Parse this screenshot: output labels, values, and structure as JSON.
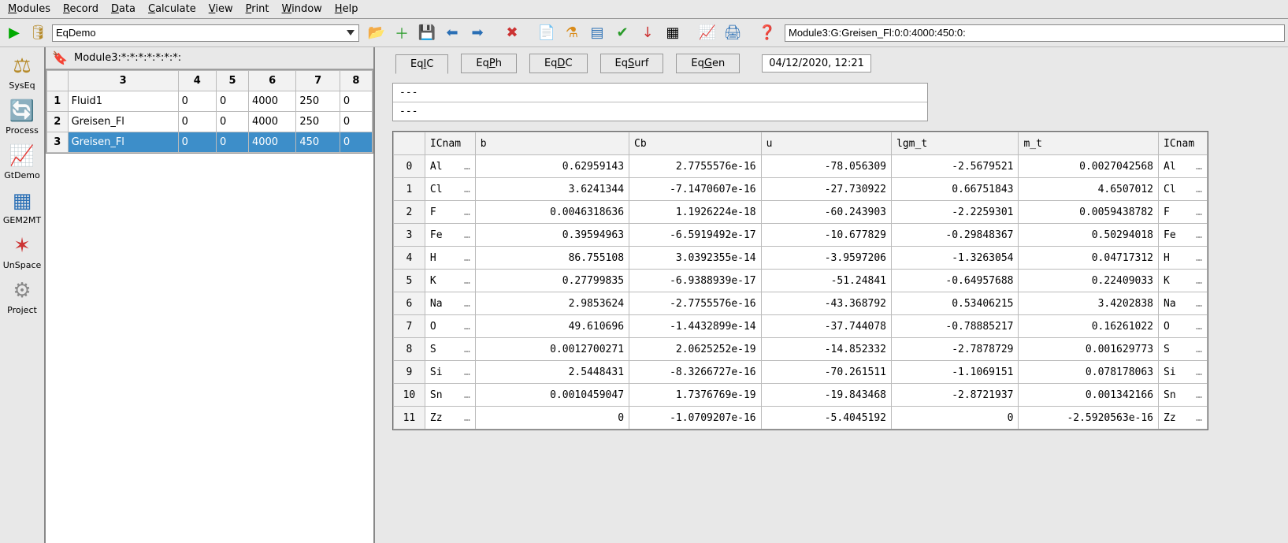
{
  "menu": [
    "Modules",
    "Record",
    "Data",
    "Calculate",
    "View",
    "Print",
    "Window",
    "Help"
  ],
  "module_selected": "EqDemo",
  "path_input": "Module3:G:Greisen_Fl:0:0:4000:450:0:",
  "mid_path": "Module3:*:*:*:*:*:*:*:",
  "rec_headers": [
    "3",
    "4",
    "5",
    "6",
    "7",
    "8"
  ],
  "rec_rows": [
    {
      "n": "1",
      "name": "Fluid1",
      "v": [
        "0",
        "0",
        "4000",
        "250",
        "0"
      ],
      "sel": false
    },
    {
      "n": "2",
      "name": "Greisen_Fl",
      "v": [
        "0",
        "0",
        "4000",
        "250",
        "0"
      ],
      "sel": false
    },
    {
      "n": "3",
      "name": "Greisen_Fl",
      "v": [
        "0",
        "0",
        "4000",
        "450",
        "0"
      ],
      "sel": true
    }
  ],
  "nav": [
    {
      "label": "SysEq",
      "icon": "⚖"
    },
    {
      "label": "Process",
      "icon": "🔄"
    },
    {
      "label": "GtDemo",
      "icon": "📈"
    },
    {
      "label": "GEM2MT",
      "icon": "▦"
    },
    {
      "label": "UnSpace",
      "icon": "✶"
    },
    {
      "label": "Project",
      "icon": "⚙"
    }
  ],
  "tabs": [
    "EqIC",
    "EqPh",
    "EqDC",
    "EqSurf",
    "EqGen"
  ],
  "active_tab": 0,
  "date": "04/12/2020, 12:21",
  "info1": "---",
  "info2": "---",
  "cols": [
    "ICnam",
    "b",
    "Cb",
    "u",
    "lgm_t",
    "m_t",
    "ICnam"
  ],
  "rows": [
    {
      "i": "0",
      "ic": "Al",
      "b": "0.62959143",
      "cb": "2.7755576e-16",
      "u": "-78.056309",
      "lgm": "-2.5679521",
      "mt": "0.0027042568",
      "ic2": "Al"
    },
    {
      "i": "1",
      "ic": "Cl",
      "b": "3.6241344",
      "cb": "-7.1470607e-16",
      "u": "-27.730922",
      "lgm": "0.66751843",
      "mt": "4.6507012",
      "ic2": "Cl"
    },
    {
      "i": "2",
      "ic": "F",
      "b": "0.0046318636",
      "cb": "1.1926224e-18",
      "u": "-60.243903",
      "lgm": "-2.2259301",
      "mt": "0.0059438782",
      "ic2": "F"
    },
    {
      "i": "3",
      "ic": "Fe",
      "b": "0.39594963",
      "cb": "-6.5919492e-17",
      "u": "-10.677829",
      "lgm": "-0.29848367",
      "mt": "0.50294018",
      "ic2": "Fe"
    },
    {
      "i": "4",
      "ic": "H",
      "b": "86.755108",
      "cb": "3.0392355e-14",
      "u": "-3.9597206",
      "lgm": "-1.3263054",
      "mt": "0.04717312",
      "ic2": "H"
    },
    {
      "i": "5",
      "ic": "K",
      "b": "0.27799835",
      "cb": "-6.9388939e-17",
      "u": "-51.24841",
      "lgm": "-0.64957688",
      "mt": "0.22409033",
      "ic2": "K"
    },
    {
      "i": "6",
      "ic": "Na",
      "b": "2.9853624",
      "cb": "-2.7755576e-16",
      "u": "-43.368792",
      "lgm": "0.53406215",
      "mt": "3.4202838",
      "ic2": "Na"
    },
    {
      "i": "7",
      "ic": "O",
      "b": "49.610696",
      "cb": "-1.4432899e-14",
      "u": "-37.744078",
      "lgm": "-0.78885217",
      "mt": "0.16261022",
      "ic2": "O"
    },
    {
      "i": "8",
      "ic": "S",
      "b": "0.0012700271",
      "cb": "2.0625252e-19",
      "u": "-14.852332",
      "lgm": "-2.7878729",
      "mt": "0.001629773",
      "ic2": "S"
    },
    {
      "i": "9",
      "ic": "Si",
      "b": "2.5448431",
      "cb": "-8.3266727e-16",
      "u": "-70.261511",
      "lgm": "-1.1069151",
      "mt": "0.078178063",
      "ic2": "Si"
    },
    {
      "i": "10",
      "ic": "Sn",
      "b": "0.0010459047",
      "cb": "1.7376769e-19",
      "u": "-19.843468",
      "lgm": "-2.8721937",
      "mt": "0.001342166",
      "ic2": "Sn"
    },
    {
      "i": "11",
      "ic": "Zz",
      "b": "0",
      "cb": "-1.0709207e-16",
      "u": "-5.4045192",
      "lgm": "0",
      "mt": "-2.5920563e-16",
      "ic2": "Zz"
    }
  ]
}
